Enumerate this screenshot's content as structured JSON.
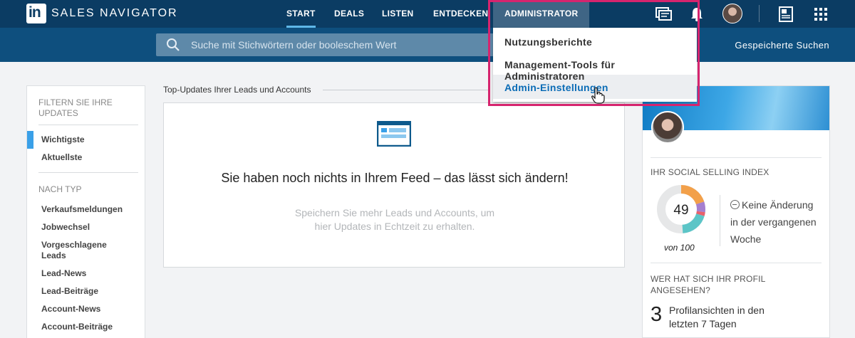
{
  "brand": {
    "logo_text": "in",
    "name": "SALES NAVIGATOR"
  },
  "nav": {
    "items": [
      {
        "label": "START",
        "active": true
      },
      {
        "label": "DEALS"
      },
      {
        "label": "LISTEN"
      },
      {
        "label": "ENTDECKEN"
      },
      {
        "label": "ADMINISTRATOR",
        "open": true
      }
    ],
    "icons": [
      "messages-icon",
      "bell-icon",
      "avatar",
      "notes-icon",
      "apps-grid-icon"
    ]
  },
  "search": {
    "placeholder": "Suche mit Stichwörtern oder booleschem Wert",
    "saved_searches_label": "Gespeicherte Suchen"
  },
  "admin_dropdown": {
    "items": [
      {
        "label": "Nutzungsberichte"
      },
      {
        "label": "Management-Tools für Administratoren"
      },
      {
        "label": "Admin-Einstellungen",
        "hovered": true
      }
    ]
  },
  "filters": {
    "heading": "FILTERN SIE IHRE UPDATES",
    "sort": [
      {
        "label": "Wichtigste",
        "selected": true
      },
      {
        "label": "Aktuellste"
      }
    ],
    "type_heading": "NACH TYP",
    "types": [
      {
        "label": "Verkaufsmeldungen"
      },
      {
        "label": "Jobwechsel"
      },
      {
        "label": "Vorgeschlagene Leads"
      },
      {
        "label": "Lead-News"
      },
      {
        "label": "Lead-Beiträge"
      },
      {
        "label": "Account-News"
      },
      {
        "label": "Account-Beiträge"
      }
    ]
  },
  "feed": {
    "section_title": "Top-Updates Ihrer Leads und Accounts",
    "empty_heading": "Sie haben noch nichts in Ihrem Feed – das lässt sich ändern!",
    "empty_text_line1": "Speichern Sie mehr Leads und Accounts, um",
    "empty_text_line2": "hier Updates in Echtzeit zu erhalten."
  },
  "profile": {
    "ssi_label": "IHR SOCIAL SELLING INDEX",
    "ssi_value": "49",
    "ssi_out_of": "von 100",
    "ssi_change_line1": "Keine Änderung",
    "ssi_change_line2": "in der vergangenen",
    "ssi_change_line3": "Woche",
    "views_label_line1": "WER HAT SICH IHR PROFIL",
    "views_label_line2": "ANGESEHEN?",
    "views_count": "3",
    "views_text_line1": "Profilansichten in den",
    "views_text_line2": "letzten 7 Tagen"
  },
  "colors": {
    "nav_bg": "#0b3c63",
    "search_band": "#0e4f7e",
    "accent": "#3aa0e8",
    "highlight_box": "#d6246e",
    "ssi_orange": "#f2a04a",
    "ssi_purple": "#a57fcf",
    "ssi_red": "#e8606b",
    "ssi_teal": "#5cc5c7"
  }
}
